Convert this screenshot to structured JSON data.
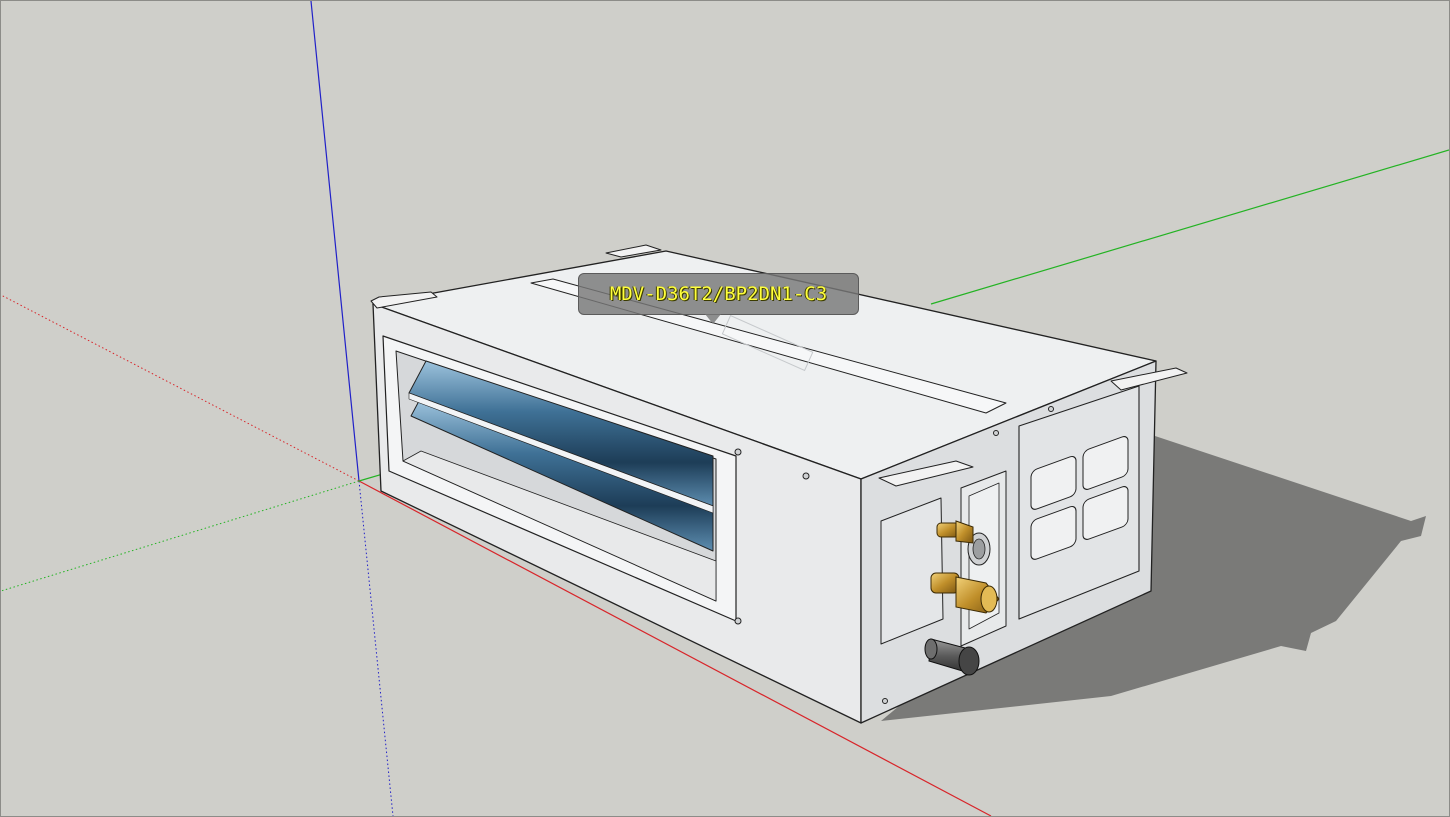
{
  "viewport": {
    "background_color": "#cfcfca",
    "axes": {
      "red": "#d8252a",
      "green": "#23b323",
      "blue": "#2020c8"
    }
  },
  "model": {
    "label": "MDV-D36T2/BP2DN1-C3",
    "label_color": "#ffff3c",
    "body_color": "#eef0f1",
    "shadow_color": "#7a7a78",
    "louver_color": "#2b5678",
    "fitting_color": "#c9a03a"
  }
}
